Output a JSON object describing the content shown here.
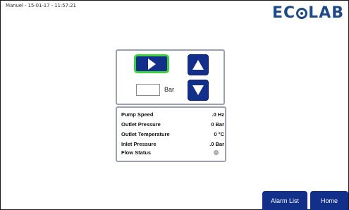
{
  "header": {
    "status_text": "Manuel - 15-01-17 - 11:57:21",
    "logo": {
      "before": "EC",
      "after": "LAB",
      "ring_icon": "ecolab-o-ring",
      "brand_color": "#1f4a8a"
    }
  },
  "controls": {
    "start_icon": "play-icon",
    "up_icon": "arrow-up-icon",
    "down_icon": "arrow-down-icon",
    "pressure_value": "",
    "pressure_unit": "Bar",
    "colors": {
      "button": "#12308a",
      "active_border": "#3cd23c"
    }
  },
  "readings": [
    {
      "label": "Pump Speed",
      "value": ".0 Hz"
    },
    {
      "label": "Outlet Pressure",
      "value": "0 Bar"
    },
    {
      "label": "Outlet Temperature",
      "value": "0 °C"
    },
    {
      "label": "Inlet Pressure",
      "value": ".0 Bar"
    },
    {
      "label": "Flow Status",
      "indicator": "grey"
    }
  ],
  "nav": {
    "alarm_label": "Alarm List",
    "home_label": "Home"
  }
}
